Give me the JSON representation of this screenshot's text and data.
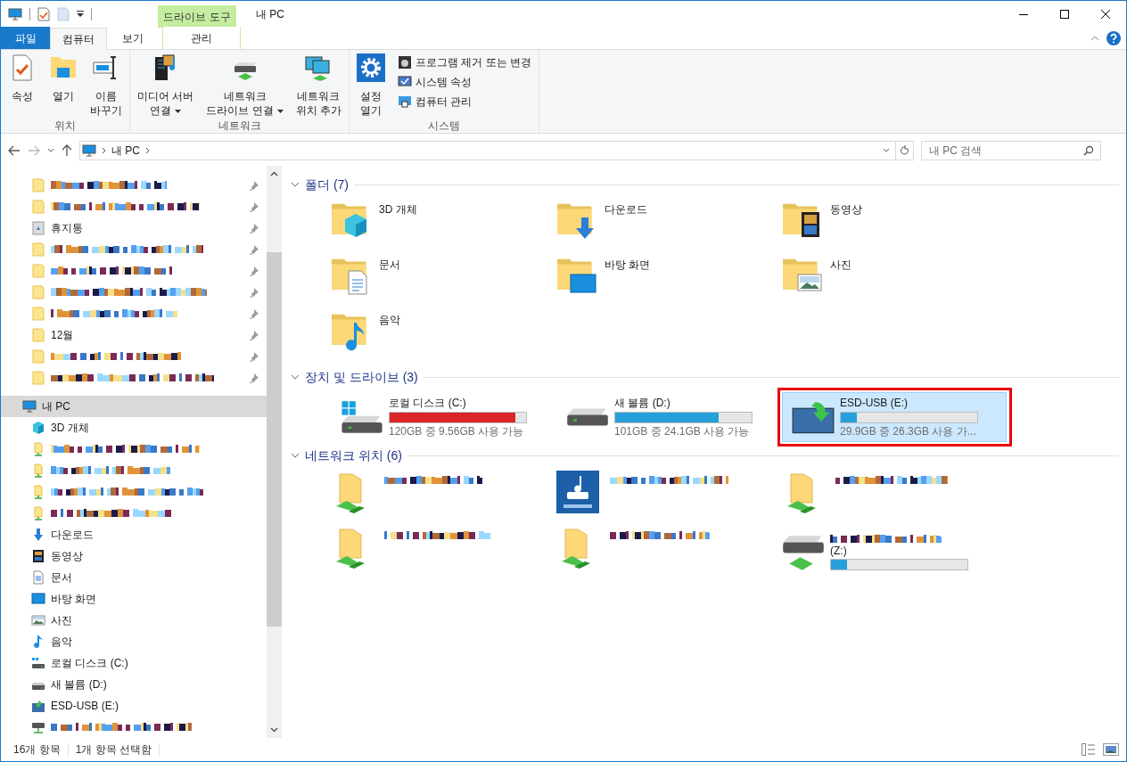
{
  "window": {
    "title": "내 PC",
    "context_tab": "드라이브 도구"
  },
  "ribbon_tabs": [
    {
      "label": "파일",
      "kind": "file",
      "selected": false
    },
    {
      "label": "컴퓨터",
      "kind": "tab",
      "selected": true
    },
    {
      "label": "보기",
      "kind": "tab",
      "selected": false
    },
    {
      "label": "관리",
      "kind": "context",
      "selected": false
    }
  ],
  "ribbon_groups": [
    {
      "title": "위치",
      "buttons": [
        {
          "kind": "large",
          "label": "속성",
          "dropdown": false
        },
        {
          "kind": "large",
          "label": "열기",
          "dropdown": false
        },
        {
          "kind": "large",
          "label": "이름\n바꾸기",
          "dropdown": false
        }
      ]
    },
    {
      "title": "네트워크",
      "buttons": [
        {
          "kind": "large",
          "label": "미디어 서버\n연결",
          "dropdown": true
        },
        {
          "kind": "large",
          "label": "네트워크\n드라이브 연결",
          "dropdown": true
        },
        {
          "kind": "large",
          "label": "네트워크\n위치 추가",
          "dropdown": false
        }
      ]
    },
    {
      "title": "시스템",
      "buttons": [
        {
          "kind": "large",
          "label": "설정\n열기",
          "dropdown": false
        },
        {
          "kind": "small",
          "label": "프로그램 제거 또는 변경",
          "dropdown": false
        },
        {
          "kind": "small",
          "label": "시스템 속성",
          "dropdown": false
        },
        {
          "kind": "small",
          "label": "컴퓨터 관리",
          "dropdown": false
        }
      ]
    }
  ],
  "address": {
    "crumb": "내 PC",
    "search_placeholder": "내 PC 검색"
  },
  "quick_access": [
    {
      "kind": "folder",
      "pinned": true
    },
    {
      "kind": "folder",
      "pinned": true
    },
    {
      "kind": "recycle",
      "label": "휴지통",
      "pinned": true
    },
    {
      "kind": "folder",
      "pinned": true
    },
    {
      "kind": "folder",
      "pinned": true
    },
    {
      "kind": "folder",
      "pinned": true
    },
    {
      "kind": "folder",
      "pinned": true
    },
    {
      "kind": "folder",
      "label": "12월",
      "pinned": true
    },
    {
      "kind": "folder",
      "pinned": true
    },
    {
      "kind": "folder",
      "pinned": true
    }
  ],
  "this_pc": {
    "label": "내 PC",
    "selected": true,
    "children": [
      {
        "kind": "objects3d",
        "label": "3D 개체"
      },
      {
        "kind": "share"
      },
      {
        "kind": "share"
      },
      {
        "kind": "share"
      },
      {
        "kind": "share"
      },
      {
        "kind": "downloads",
        "label": "다운로드"
      },
      {
        "kind": "videos",
        "label": "동영상"
      },
      {
        "kind": "documents",
        "label": "문서"
      },
      {
        "kind": "desktop",
        "label": "바탕 화면"
      },
      {
        "kind": "pictures",
        "label": "사진"
      },
      {
        "kind": "music",
        "label": "음악"
      },
      {
        "kind": "system-drive",
        "label": "로컬 디스크 (C:)"
      },
      {
        "kind": "drive",
        "label": "새 볼륨 (D:)"
      },
      {
        "kind": "usb-drive",
        "label": "ESD-USB (E:)"
      },
      {
        "kind": "mapped-drive"
      }
    ]
  },
  "sections": [
    {
      "title": "폴더 (7)",
      "expanded": true,
      "items": [
        {
          "kind": "objects3d",
          "label": "3D 개체"
        },
        {
          "kind": "downloads",
          "label": "다운로드"
        },
        {
          "kind": "videos",
          "label": "동영상"
        },
        {
          "kind": "documents",
          "label": "문서"
        },
        {
          "kind": "desktop",
          "label": "바탕 화면"
        },
        {
          "kind": "pictures",
          "label": "사진"
        },
        {
          "kind": "music",
          "label": "음악"
        }
      ]
    },
    {
      "title": "장치 및 드라이브 (3)",
      "expanded": true,
      "items": [
        {
          "kind": "system-drive",
          "label": "로컬 디스크 (C:)",
          "level": 0.92,
          "color": "#da2626",
          "info": "120GB 중 9.56GB 사용 가능",
          "selected": false,
          "annotated": false
        },
        {
          "kind": "drive",
          "label": "새 볼륨 (D:)",
          "level": 0.76,
          "color": "#26a0da",
          "info": "101GB 중 24.1GB 사용 가능",
          "selected": false,
          "annotated": false
        },
        {
          "kind": "usb-drive",
          "label": "ESD-USB (E:)",
          "level": 0.12,
          "color": "#26a0da",
          "info": "29.9GB 중 26.3GB 사용 가...",
          "selected": true,
          "annotated": true
        }
      ]
    },
    {
      "title": "네트워크 위치 (6)",
      "expanded": true,
      "items": [
        {
          "kind": "share"
        },
        {
          "kind": "nas"
        },
        {
          "kind": "share"
        },
        {
          "kind": "share"
        },
        {
          "kind": "share"
        },
        {
          "kind": "mapped-drive",
          "label": "(Z:)",
          "level": 0.12,
          "color": "#26a0da"
        }
      ]
    }
  ],
  "status_bar": {
    "count": "16개 항목",
    "selection": "1개 항목 선택함"
  }
}
